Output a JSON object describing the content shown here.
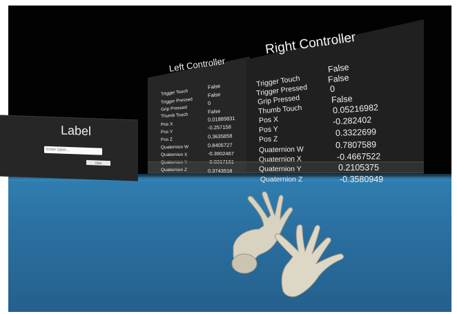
{
  "label_panel": {
    "title": "Label",
    "input_placeholder": "Enter label...",
    "button_label": "Clear"
  },
  "left_controller": {
    "title": "Left Controller",
    "rows": [
      {
        "label": "Trigger Touch",
        "value": "False"
      },
      {
        "label": "Trigger Pressed",
        "value": "False"
      },
      {
        "label": "Grip Pressed",
        "value": "0"
      },
      {
        "label": "Thumb Touch",
        "value": "False"
      },
      {
        "label": "Pos X",
        "value": "0.01889831"
      },
      {
        "label": "Pos Y",
        "value": "-0.257158"
      },
      {
        "label": "Pos Z",
        "value": "0.3635858"
      },
      {
        "label": "Quaternion W",
        "value": "0.8405727"
      },
      {
        "label": "Quaternion X",
        "value": "-0.3902467"
      },
      {
        "label": "Quaternion Y",
        "value": "-0.0317161"
      },
      {
        "label": "Quaternion Z",
        "value": "0.3743518"
      }
    ]
  },
  "right_controller": {
    "title": "Right Controller",
    "rows": [
      {
        "label": "Trigger Touch",
        "value": "False"
      },
      {
        "label": "Trigger Pressed",
        "value": "False"
      },
      {
        "label": "Grip Pressed",
        "value": "0"
      },
      {
        "label": "Thumb Touch",
        "value": "False"
      },
      {
        "label": "Pos X",
        "value": "0.05216982"
      },
      {
        "label": "Pos Y",
        "value": "-0.282402"
      },
      {
        "label": "Pos Z",
        "value": "0.3322699"
      },
      {
        "label": "Quaternion W",
        "value": "0.7807589"
      },
      {
        "label": "Quaternion X",
        "value": "-0.4667522"
      },
      {
        "label": "Quaternion Y",
        "value": "0.2105375"
      },
      {
        "label": "Quaternion Z",
        "value": "-0.3580949"
      }
    ]
  },
  "colors": {
    "panel": "#262626",
    "sea": "#2a6fa0",
    "hand": "#d8d2c0"
  }
}
